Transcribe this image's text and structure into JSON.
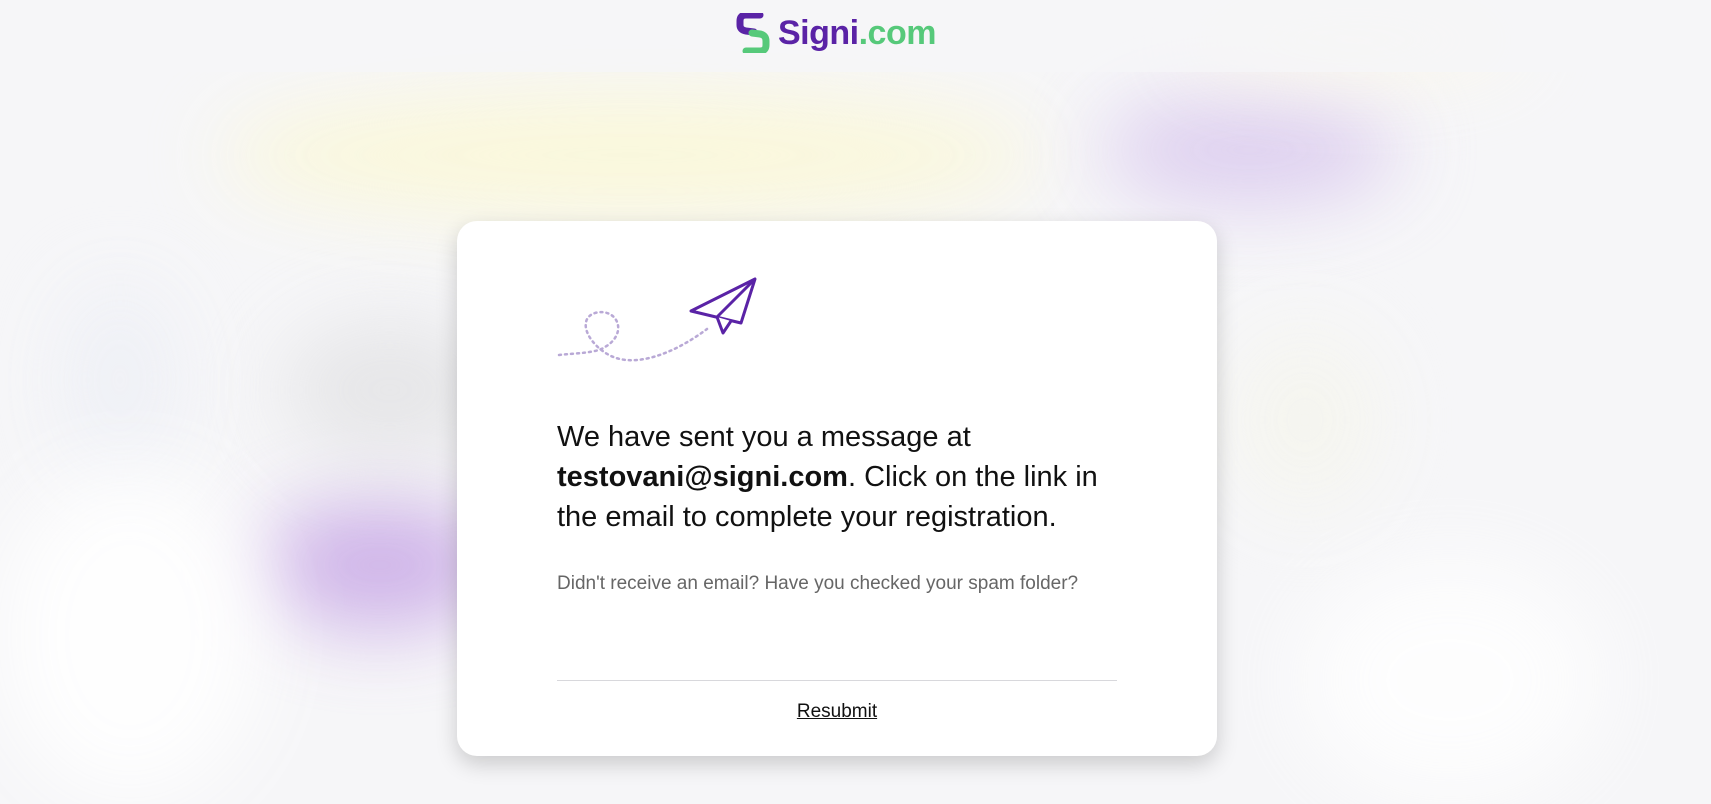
{
  "header": {
    "logo": {
      "name": "Signi",
      "domain": ".com",
      "icon": "signi-logo-icon"
    }
  },
  "card": {
    "illustration": "paper-plane-icon",
    "message": {
      "part1": "We have sent you a message at ",
      "email": "testovani@signi.com",
      "part2": ". Click on the link in the email to complete your registration."
    },
    "subtext": "Didn't receive an email? Have you checked your spam folder?",
    "resubmit_label": "Resubmit"
  },
  "colors": {
    "brand_purple": "#5a23a6",
    "brand_green": "#56c97a",
    "text": "#111111",
    "muted_text": "#666666"
  }
}
